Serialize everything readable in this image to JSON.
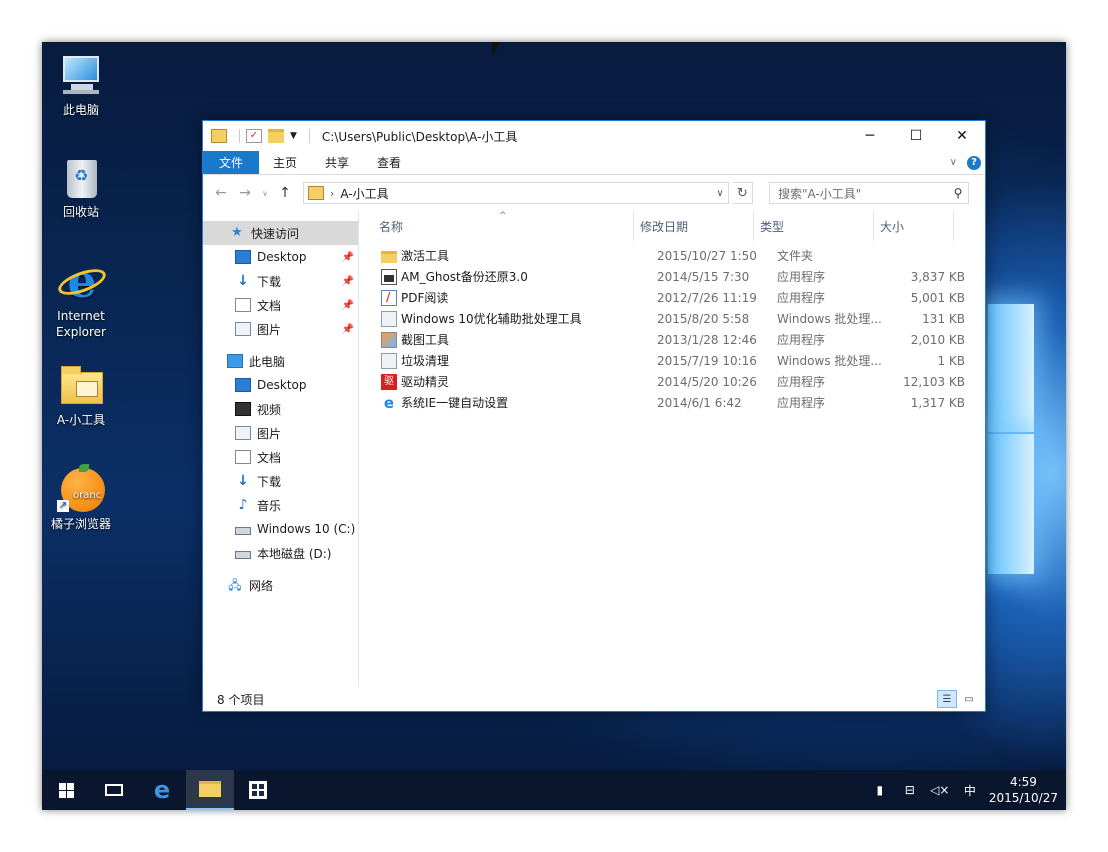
{
  "desktop": {
    "icons": [
      {
        "label": "此电脑",
        "icon": "this-pc-icon"
      },
      {
        "label": "回收站",
        "icon": "recycle-bin-icon"
      },
      {
        "label": "Internet\nExplorer",
        "icon": "internet-explorer-icon"
      },
      {
        "label": "A-小工具",
        "icon": "folder-icon"
      },
      {
        "label": "橘子浏览器",
        "icon": "orange-browser-icon"
      }
    ],
    "ie_line1": "Internet",
    "ie_line2": "Explorer",
    "orange_text": "oranc"
  },
  "window": {
    "title": "C:\\Users\\Public\\Desktop\\A-小工具",
    "minimize": "─",
    "maximize": "☐",
    "close": "✕",
    "ribbon_tabs": [
      "文件",
      "主页",
      "共享",
      "查看"
    ],
    "help": "?",
    "address_current": "A-小工具",
    "search_placeholder": "搜索\"A-小工具\"",
    "columns": {
      "name": "名称",
      "date": "修改日期",
      "type": "类型",
      "size": "大小"
    },
    "files": [
      {
        "name": "激活工具",
        "date": "2015/10/27 1:50",
        "type": "文件夹",
        "size": "",
        "icon": "folder-icon"
      },
      {
        "name": "AM_Ghost备份还原3.0",
        "date": "2014/5/15 7:30",
        "type": "应用程序",
        "size": "3,837 KB",
        "icon": "app-icon"
      },
      {
        "name": "PDF阅读",
        "date": "2012/7/26 11:19",
        "type": "应用程序",
        "size": "5,001 KB",
        "icon": "pdf-icon"
      },
      {
        "name": "Windows 10优化辅助批处理工具",
        "date": "2015/8/20 5:58",
        "type": "Windows 批处理...",
        "size": "131 KB",
        "icon": "batch-icon"
      },
      {
        "name": "截图工具",
        "date": "2013/1/28 12:46",
        "type": "应用程序",
        "size": "2,010 KB",
        "icon": "screenshot-icon"
      },
      {
        "name": "垃圾清理",
        "date": "2015/7/19 10:16",
        "type": "Windows 批处理...",
        "size": "1 KB",
        "icon": "batch-icon"
      },
      {
        "name": "驱动精灵",
        "date": "2014/5/20 10:26",
        "type": "应用程序",
        "size": "12,103 KB",
        "icon": "driver-icon"
      },
      {
        "name": "系统IE一键自动设置",
        "date": "2014/6/1 6:42",
        "type": "应用程序",
        "size": "1,317 KB",
        "icon": "ie-icon"
      }
    ],
    "nav": {
      "quick_access": "快速访问",
      "quick_items": [
        "Desktop",
        "下载",
        "文档",
        "图片"
      ],
      "this_pc": "此电脑",
      "pc_items": [
        "Desktop",
        "视频",
        "图片",
        "文档",
        "下载",
        "音乐",
        "Windows 10 (C:)",
        "本地磁盘 (D:)"
      ],
      "network": "网络"
    },
    "status": "8 个项目"
  },
  "taskbar": {
    "ime": "中",
    "time": "4:59",
    "date": "2015/10/27"
  },
  "colors": {
    "accent": "#1979ca",
    "taskbar": "#0a162c"
  }
}
